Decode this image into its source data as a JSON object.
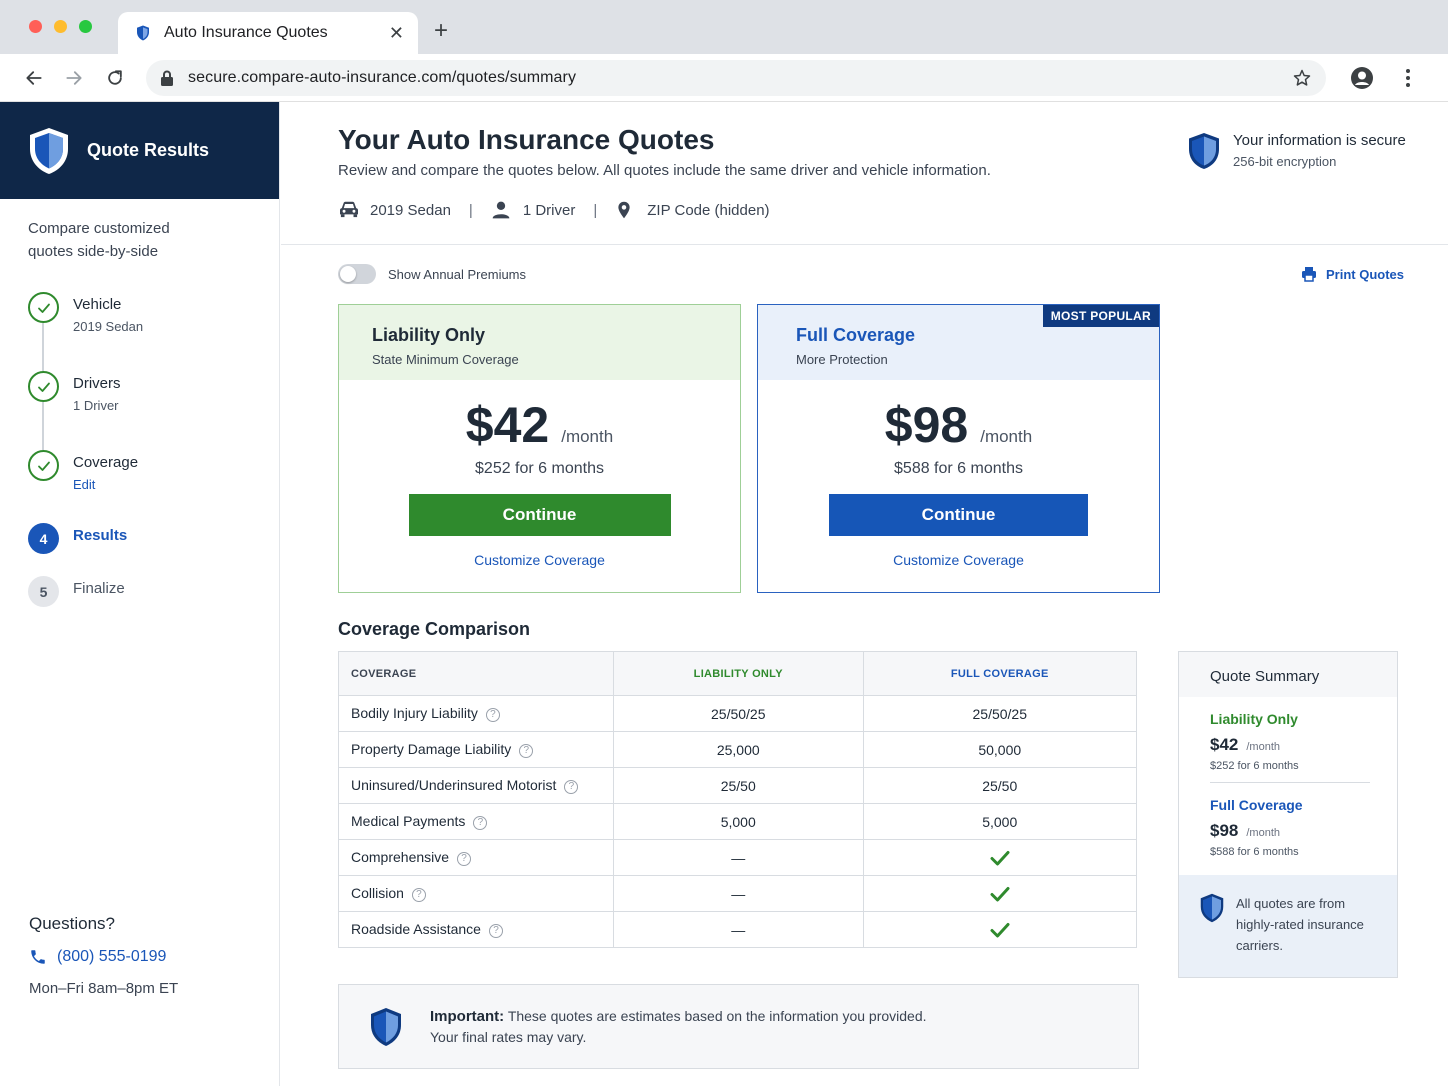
{
  "browser": {
    "tab_title": "Auto Insurance Quotes",
    "url": "secure.compare-auto-insurance.com/quotes/summary"
  },
  "sidebar": {
    "title": "Quote Results",
    "subtitle": "Compare customized quotes side-by-side",
    "steps": [
      {
        "label": "Vehicle",
        "detail": "2019 Sedan",
        "state": "done"
      },
      {
        "label": "Drivers",
        "detail": "1 Driver",
        "state": "done"
      },
      {
        "label": "Coverage",
        "detail": "Edit",
        "state": "done"
      },
      {
        "number": "4",
        "label": "Results",
        "state": "active"
      },
      {
        "number": "5",
        "label": "Finalize",
        "state": "pending"
      }
    ],
    "help": {
      "title": "Questions?",
      "phone": "(800) 555-0199",
      "hours": "Mon–Fri  8am–8pm ET"
    }
  },
  "header": {
    "title": "Your Auto Insurance Quotes",
    "description": "Review and compare the quotes below. All quotes include the same driver and vehicle information.",
    "vehicle": "2019 Sedan",
    "drivers": "1 Driver",
    "zip": "ZIP Code (hidden)",
    "separator": "|",
    "secure_title": "Your information is secure",
    "secure_sub": "256-bit encryption"
  },
  "controls": {
    "toggle_label": "Show Annual Premiums",
    "toggle_on": false,
    "print_label": "Print Quotes"
  },
  "plans": [
    {
      "name": "Liability Only",
      "subtitle": "State Minimum Coverage",
      "price": "$42",
      "per": "/month",
      "six_month": "$252 for 6 months",
      "cta": "Continue",
      "customize": "Customize Coverage"
    },
    {
      "name": "Full Coverage",
      "subtitle": "More Protection",
      "badge": "MOST POPULAR",
      "price": "$98",
      "per": "/month",
      "six_month": "$588 for 6 months",
      "cta": "Continue",
      "customize": "Customize Coverage"
    }
  ],
  "comparison": {
    "title": "Coverage Comparison",
    "headers": [
      "COVERAGE",
      "LIABILITY ONLY",
      "FULL COVERAGE"
    ],
    "rows": [
      {
        "coverage": "Bodily Injury Liability",
        "liability": "25/50/25",
        "full": "25/50/25"
      },
      {
        "coverage": "Property Damage Liability",
        "liability": "25,000",
        "full": "50,000"
      },
      {
        "coverage": "Uninsured/Underinsured Motorist",
        "liability": "25/50",
        "full": "25/50"
      },
      {
        "coverage": "Medical Payments",
        "liability": "5,000",
        "full": "5,000"
      },
      {
        "coverage": "Comprehensive",
        "liability": "—",
        "full": "check"
      },
      {
        "coverage": "Collision",
        "liability": "—",
        "full": "check"
      },
      {
        "coverage": "Roadside Assistance",
        "liability": "—",
        "full": "check"
      }
    ]
  },
  "notice": {
    "bold": "Important:",
    "text": "These quotes are estimates based on the information you provided.",
    "text2": "Your final rates may vary."
  },
  "summary": {
    "title": "Quote Summary",
    "items": [
      {
        "name": "Liability Only",
        "price": "$42",
        "per": "/month",
        "six_month": "$252 for 6 months"
      },
      {
        "name": "Full Coverage",
        "price": "$98",
        "per": "/month",
        "six_month": "$588 for 6 months"
      }
    ],
    "footer": "All quotes are from highly-rated insurance carriers."
  },
  "colors": {
    "navy": "#0f2748",
    "blue": "#1a56b8",
    "green": "#2f8a2d"
  },
  "icons": {
    "help": "?"
  }
}
